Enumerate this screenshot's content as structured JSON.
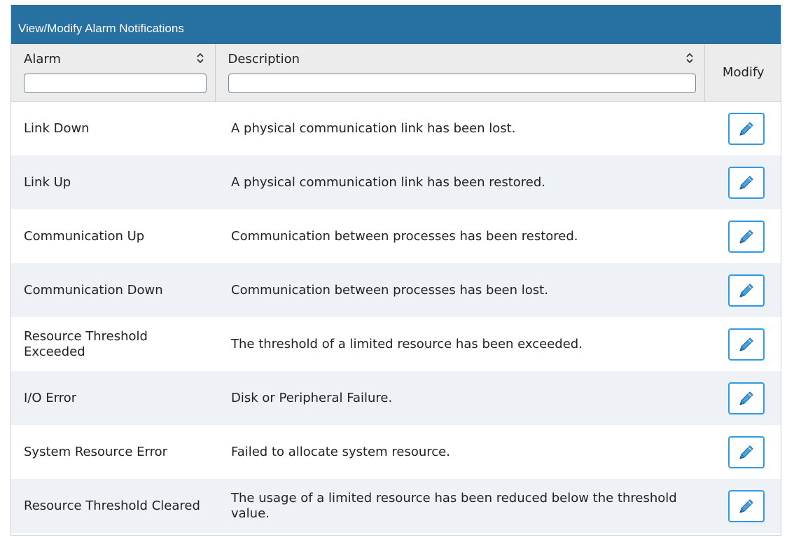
{
  "panel": {
    "title": "View/Modify Alarm Notifications"
  },
  "columns": {
    "alarm": {
      "label": "Alarm",
      "filter_value": ""
    },
    "description": {
      "label": "Description",
      "filter_value": ""
    },
    "modify": {
      "label": "Modify"
    }
  },
  "rows": [
    {
      "alarm": "Link Down",
      "description": "A physical communication link has been lost."
    },
    {
      "alarm": "Link Up",
      "description": "A physical communication link has been restored."
    },
    {
      "alarm": "Communication Up",
      "description": "Communication between processes has been restored."
    },
    {
      "alarm": "Communication Down",
      "description": "Communication between processes has been lost."
    },
    {
      "alarm": "Resource Threshold Exceeded",
      "description": "The threshold of a limited resource has been exceeded."
    },
    {
      "alarm": "I/O Error",
      "description": "Disk or Peripheral Failure."
    },
    {
      "alarm": "System Resource Error",
      "description": "Failed to allocate system resource."
    },
    {
      "alarm": "Resource Threshold Cleared",
      "description": "The usage of a limited resource has been reduced below the threshold value."
    }
  ],
  "icons": {
    "sort": "sort-icon",
    "edit": "pencil-icon"
  },
  "colors": {
    "title_bar": "#2770a2",
    "edit_border": "#2f9be0",
    "row_alt": "#eef2f6"
  }
}
